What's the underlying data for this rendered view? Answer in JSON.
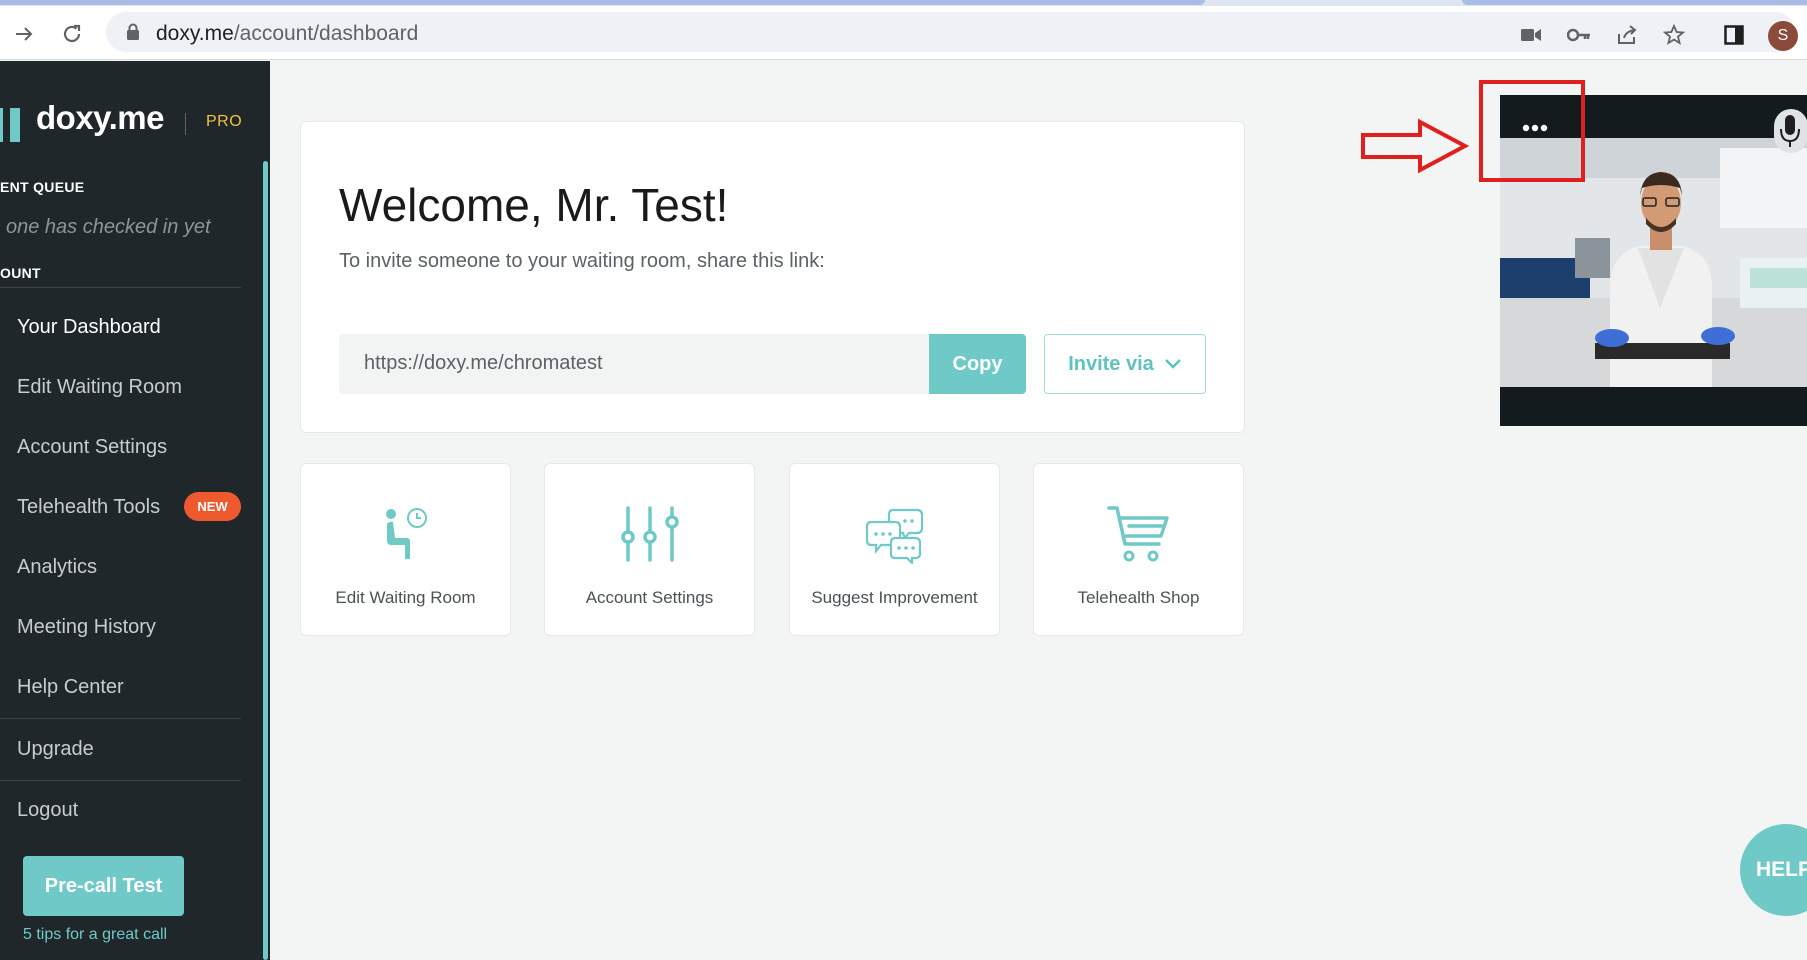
{
  "browser": {
    "url_host": "doxy.me",
    "url_path": "/account/dashboard",
    "profile_initial": "S"
  },
  "sidebar": {
    "logo_text": "doxy.me",
    "plan_badge": "PRO",
    "queue_heading": "ENT QUEUE",
    "queue_empty_text": "one has checked in yet",
    "account_heading": "OUNT",
    "items": [
      {
        "label": "Your Dashboard",
        "active": true
      },
      {
        "label": "Edit Waiting Room"
      },
      {
        "label": "Account Settings"
      },
      {
        "label": "Telehealth Tools",
        "badge": "NEW"
      },
      {
        "label": "Analytics"
      },
      {
        "label": "Meeting History"
      },
      {
        "label": "Help Center"
      },
      {
        "label": "Upgrade"
      },
      {
        "label": "Logout"
      }
    ],
    "precall_button": "Pre-call Test",
    "tips_link": "5 tips for a great call"
  },
  "welcome": {
    "title": "Welcome, Mr. Test!",
    "subtitle": "To invite someone to your waiting room, share this link:",
    "room_link": "https://doxy.me/chromatest",
    "copy_label": "Copy",
    "invite_label": "Invite via"
  },
  "tiles": [
    {
      "label": "Edit Waiting Room",
      "icon": "waiting-room-icon"
    },
    {
      "label": "Account Settings",
      "icon": "sliders-icon"
    },
    {
      "label": "Suggest Improvement",
      "icon": "chat-bubbles-icon"
    },
    {
      "label": "Telehealth Shop",
      "icon": "cart-icon"
    }
  ],
  "help_button": "HELP",
  "colors": {
    "accent": "#6fc9c7",
    "sidebar_bg": "#1f272b",
    "badge": "#ee5a2e",
    "pro": "#f0c241",
    "annotation": "#e0201f"
  }
}
